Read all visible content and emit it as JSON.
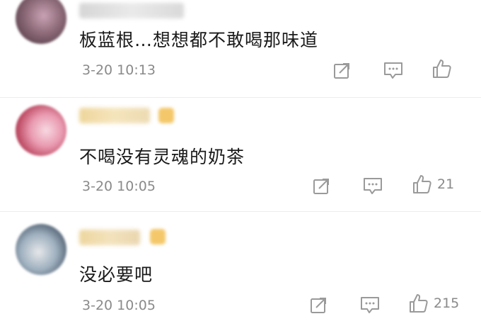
{
  "comments": [
    {
      "text": "板蓝根…想想都不敢喝那味道",
      "time": "3-20 10:13",
      "likes": "",
      "avatar_colors": [
        "#7a5a66",
        "#c9a3b4",
        "#efd8e0"
      ],
      "has_badge": false
    },
    {
      "text": "不喝没有灵魂的奶茶",
      "time": "3-20 10:05",
      "likes": "21",
      "avatar_colors": [
        "#c24a63",
        "#e99ab0",
        "#f7d9e2"
      ],
      "has_badge": true
    },
    {
      "text": "没必要吧",
      "time": "3-20 10:05",
      "likes": "215",
      "avatar_colors": [
        "#3b4a5c",
        "#9fb0bf",
        "#e6e8ea"
      ],
      "has_badge": true
    }
  ],
  "colors": {
    "meta_text": "#8a8a8a",
    "icon_stroke": "#9a9a9a",
    "badge": "#f3c25a"
  }
}
